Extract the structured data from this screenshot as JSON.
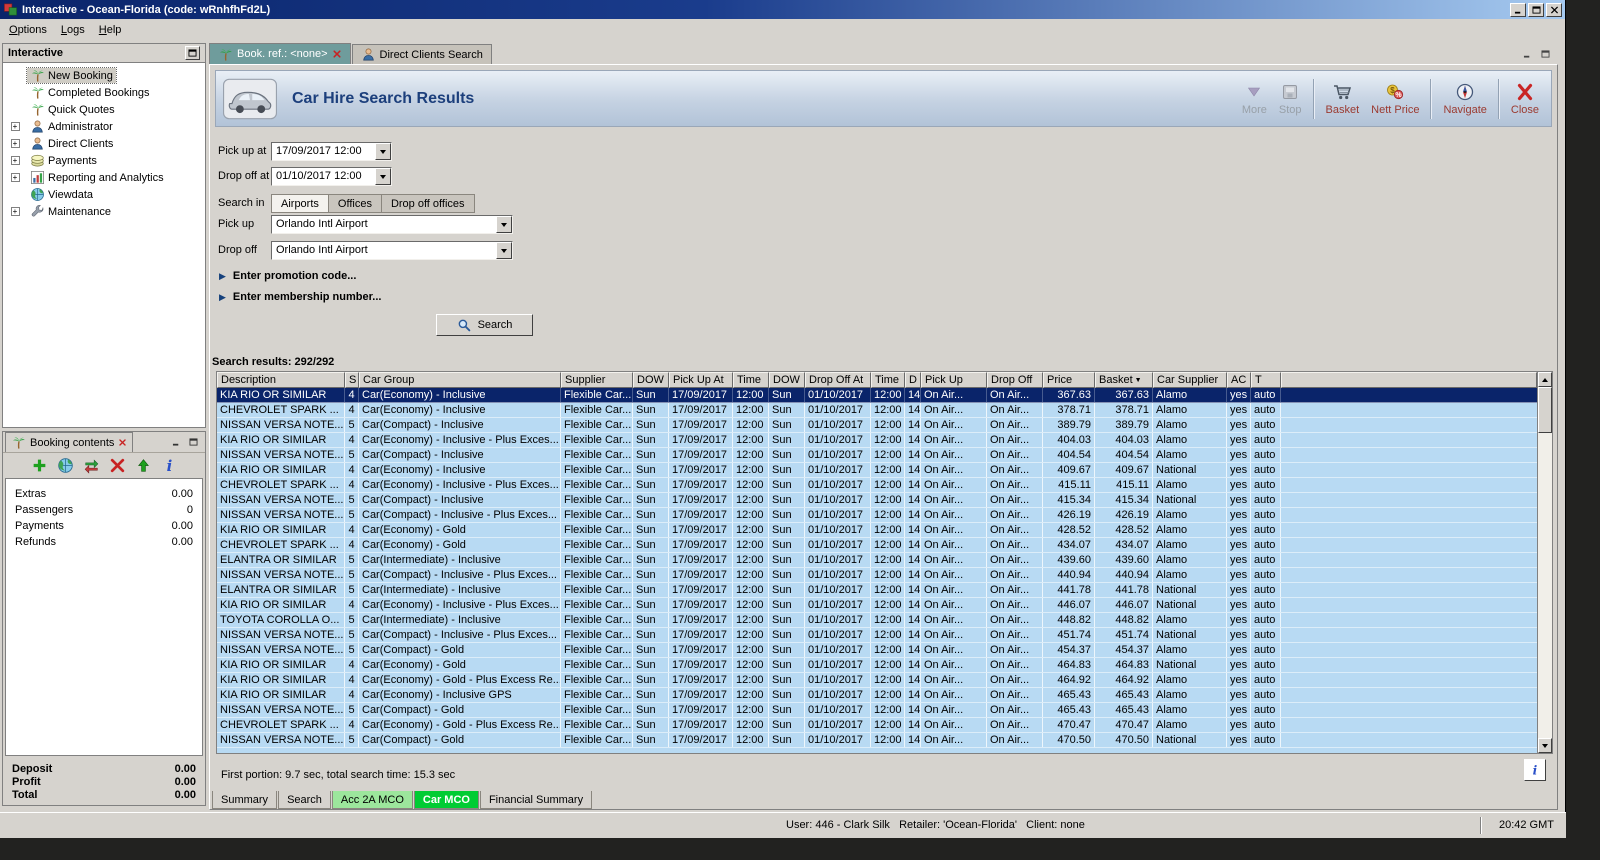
{
  "window": {
    "title": "Interactive - Ocean-Florida (code: wRnhfhFd2L)",
    "menu": [
      "Options",
      "Logs",
      "Help"
    ]
  },
  "colors": {
    "titlebar_blue": "#0a246a",
    "panel_gray": "#d6d3ce",
    "row_blue": "#b8daf3",
    "selected_row_navy": "#0a246a",
    "active_tab_green": "#00cc33",
    "pale_tab_green": "#9ce69c",
    "toolbar_label_maroon": "#9b3a30"
  },
  "sidebar": {
    "title": "Interactive",
    "items": [
      {
        "label": "New Booking",
        "icon": "palm-icon",
        "selected": true,
        "expandable": false
      },
      {
        "label": "Completed Bookings",
        "icon": "palm-icon",
        "selected": false,
        "expandable": false
      },
      {
        "label": "Quick Quotes",
        "icon": "palm-icon",
        "selected": false,
        "expandable": false
      },
      {
        "label": "Administrator",
        "icon": "person-icon",
        "selected": false,
        "expandable": true
      },
      {
        "label": "Direct Clients",
        "icon": "person-icon",
        "selected": false,
        "expandable": true
      },
      {
        "label": "Payments",
        "icon": "money-icon",
        "selected": false,
        "expandable": true
      },
      {
        "label": "Reporting and Analytics",
        "icon": "chart-icon",
        "selected": false,
        "expandable": true
      },
      {
        "label": "Viewdata",
        "icon": "globe-icon",
        "selected": false,
        "expandable": false
      },
      {
        "label": "Maintenance",
        "icon": "wrench-icon",
        "selected": false,
        "expandable": true
      }
    ]
  },
  "booking_contents": {
    "title": "Booking contents",
    "toolbar_icons": [
      "add-icon",
      "globe-icon",
      "transfer-icon",
      "delete-icon",
      "move-up-icon",
      "info-icon"
    ],
    "rows": [
      {
        "label": "Extras",
        "value": "0.00"
      },
      {
        "label": "Passengers",
        "value": "0"
      },
      {
        "label": "Payments",
        "value": "0.00"
      },
      {
        "label": "Refunds",
        "value": "0.00"
      }
    ],
    "totals": [
      {
        "label": "Deposit",
        "value": "0.00"
      },
      {
        "label": "Profit",
        "value": "0.00"
      },
      {
        "label": "Total",
        "value": "0.00"
      }
    ]
  },
  "tabs": [
    {
      "label": "Book. ref.: <none>",
      "icon": "palm-icon",
      "active": true,
      "closable": true
    },
    {
      "label": "Direct Clients Search",
      "icon": "person-icon",
      "active": false,
      "closable": false
    }
  ],
  "main": {
    "title": "Car Hire Search Results",
    "toolbar": [
      {
        "label": "More",
        "icon": "more-icon",
        "disabled": true,
        "group": 1
      },
      {
        "label": "Stop",
        "icon": "stop-icon",
        "disabled": true,
        "group": 1
      },
      {
        "label": "Basket",
        "icon": "basket-icon",
        "disabled": false,
        "group": 2
      },
      {
        "label": "Nett Price",
        "icon": "nett-price-icon",
        "disabled": false,
        "group": 2
      },
      {
        "label": "Navigate",
        "icon": "navigate-icon",
        "disabled": false,
        "group": 3
      },
      {
        "label": "Close",
        "icon": "close-icon",
        "disabled": false,
        "group": 4
      }
    ],
    "form": {
      "pickup_at_label": "Pick up at",
      "pickup_at_value": "17/09/2017 12:00",
      "dropoff_at_label": "Drop off at",
      "dropoff_at_value": "01/10/2017 12:00",
      "search_in_label": "Search in",
      "search_in_tabs": [
        "Airports",
        "Offices",
        "Drop off offices"
      ],
      "search_in_active": "Airports",
      "pickup_label": "Pick up",
      "pickup_value": "Orlando Intl Airport",
      "dropoff_label": "Drop off",
      "dropoff_value": "Orlando Intl Airport",
      "promotion_toggle": "Enter promotion code...",
      "membership_toggle": "Enter membership number...",
      "search_button": "Search"
    },
    "results_label": "Search results: 292/292",
    "table": {
      "columns": [
        "Description",
        "S",
        "Car Group",
        "Supplier",
        "DOW",
        "Pick Up At",
        "Time",
        "DOW",
        "Drop Off At",
        "Time",
        "D",
        "Pick Up",
        "Drop Off",
        "Price",
        "Basket",
        "Car Supplier",
        "AC",
        "T"
      ],
      "sort_column": "Basket",
      "selected_row": 0,
      "shared": {
        "supplier": "Flexible Car...",
        "dow_pickup": "Sun",
        "pickup_date": "17/09/2017",
        "pickup_time": "12:00",
        "dow_dropoff": "Sun",
        "dropoff_date": "01/10/2017",
        "dropoff_time": "12:00",
        "days": "14",
        "pickup_office": "On Air...",
        "dropoff_office": "On Air...",
        "ac": "yes",
        "transmission": "auto"
      },
      "rows": [
        {
          "description": "KIA RIO OR SIMILAR",
          "seats": "4",
          "car_group": "Car(Economy) - Inclusive",
          "price": "367.63",
          "basket": "367.63",
          "car_supplier": "Alamo"
        },
        {
          "description": "CHEVROLET SPARK ...",
          "seats": "4",
          "car_group": "Car(Economy) - Inclusive",
          "price": "378.71",
          "basket": "378.71",
          "car_supplier": "Alamo"
        },
        {
          "description": "NISSAN VERSA NOTE...",
          "seats": "5",
          "car_group": "Car(Compact) - Inclusive",
          "price": "389.79",
          "basket": "389.79",
          "car_supplier": "Alamo"
        },
        {
          "description": "KIA RIO OR SIMILAR",
          "seats": "4",
          "car_group": "Car(Economy) - Inclusive - Plus Exces...",
          "price": "404.03",
          "basket": "404.03",
          "car_supplier": "Alamo"
        },
        {
          "description": "NISSAN VERSA NOTE...",
          "seats": "5",
          "car_group": "Car(Compact) - Inclusive",
          "price": "404.54",
          "basket": "404.54",
          "car_supplier": "Alamo"
        },
        {
          "description": "KIA RIO OR SIMILAR",
          "seats": "4",
          "car_group": "Car(Economy) - Inclusive",
          "price": "409.67",
          "basket": "409.67",
          "car_supplier": "National"
        },
        {
          "description": "CHEVROLET SPARK ...",
          "seats": "4",
          "car_group": "Car(Economy) - Inclusive - Plus Exces...",
          "price": "415.11",
          "basket": "415.11",
          "car_supplier": "Alamo"
        },
        {
          "description": "NISSAN VERSA NOTE...",
          "seats": "5",
          "car_group": "Car(Compact) - Inclusive",
          "price": "415.34",
          "basket": "415.34",
          "car_supplier": "National"
        },
        {
          "description": "NISSAN VERSA NOTE...",
          "seats": "5",
          "car_group": "Car(Compact) - Inclusive - Plus Exces...",
          "price": "426.19",
          "basket": "426.19",
          "car_supplier": "Alamo"
        },
        {
          "description": "KIA RIO OR SIMILAR",
          "seats": "4",
          "car_group": "Car(Economy) - Gold",
          "price": "428.52",
          "basket": "428.52",
          "car_supplier": "Alamo"
        },
        {
          "description": "CHEVROLET SPARK ...",
          "seats": "4",
          "car_group": "Car(Economy) - Gold",
          "price": "434.07",
          "basket": "434.07",
          "car_supplier": "Alamo"
        },
        {
          "description": "ELANTRA OR SIMILAR",
          "seats": "5",
          "car_group": "Car(Intermediate) - Inclusive",
          "price": "439.60",
          "basket": "439.60",
          "car_supplier": "Alamo"
        },
        {
          "description": "NISSAN VERSA NOTE...",
          "seats": "5",
          "car_group": "Car(Compact) - Inclusive - Plus Exces...",
          "price": "440.94",
          "basket": "440.94",
          "car_supplier": "Alamo"
        },
        {
          "description": "ELANTRA OR SIMILAR",
          "seats": "5",
          "car_group": "Car(Intermediate) - Inclusive",
          "price": "441.78",
          "basket": "441.78",
          "car_supplier": "National"
        },
        {
          "description": "KIA RIO OR SIMILAR",
          "seats": "4",
          "car_group": "Car(Economy) - Inclusive - Plus Exces...",
          "price": "446.07",
          "basket": "446.07",
          "car_supplier": "National"
        },
        {
          "description": "TOYOTA COROLLA O...",
          "seats": "5",
          "car_group": "Car(Intermediate) - Inclusive",
          "price": "448.82",
          "basket": "448.82",
          "car_supplier": "Alamo"
        },
        {
          "description": "NISSAN VERSA NOTE...",
          "seats": "5",
          "car_group": "Car(Compact) - Inclusive - Plus Exces...",
          "price": "451.74",
          "basket": "451.74",
          "car_supplier": "National"
        },
        {
          "description": "NISSAN VERSA NOTE...",
          "seats": "5",
          "car_group": "Car(Compact) - Gold",
          "price": "454.37",
          "basket": "454.37",
          "car_supplier": "Alamo"
        },
        {
          "description": "KIA RIO OR SIMILAR",
          "seats": "4",
          "car_group": "Car(Economy) - Gold",
          "price": "464.83",
          "basket": "464.83",
          "car_supplier": "National"
        },
        {
          "description": "KIA RIO OR SIMILAR",
          "seats": "4",
          "car_group": "Car(Economy) - Gold - Plus Excess Re...",
          "price": "464.92",
          "basket": "464.92",
          "car_supplier": "Alamo"
        },
        {
          "description": "KIA RIO OR SIMILAR",
          "seats": "4",
          "car_group": "Car(Economy) - Inclusive GPS",
          "price": "465.43",
          "basket": "465.43",
          "car_supplier": "Alamo"
        },
        {
          "description": "NISSAN VERSA NOTE...",
          "seats": "5",
          "car_group": "Car(Compact) - Gold",
          "price": "465.43",
          "basket": "465.43",
          "car_supplier": "Alamo"
        },
        {
          "description": "CHEVROLET SPARK ...",
          "seats": "4",
          "car_group": "Car(Economy) - Gold -  Plus Excess Re...",
          "price": "470.47",
          "basket": "470.47",
          "car_supplier": "Alamo"
        },
        {
          "description": "NISSAN VERSA NOTE...",
          "seats": "5",
          "car_group": "Car(Compact) - Gold",
          "price": "470.50",
          "basket": "470.50",
          "car_supplier": "National"
        }
      ]
    },
    "status_text": "First portion: 9.7 sec, total search time: 15.3 sec",
    "bottom_tabs": [
      {
        "label": "Summary",
        "highlight": null,
        "active": false
      },
      {
        "label": "Search",
        "highlight": null,
        "active": false
      },
      {
        "label": "Acc 2A MCO",
        "highlight": "pale-green",
        "active": false
      },
      {
        "label": "Car MCO",
        "highlight": "green",
        "active": true
      },
      {
        "label": "Financial Summary",
        "highlight": null,
        "active": false
      }
    ]
  },
  "statusbar": {
    "user": "User: 446 - Clark Silk   Retailer: 'Ocean-Florida'   Client: none",
    "time": "20:42 GMT"
  }
}
